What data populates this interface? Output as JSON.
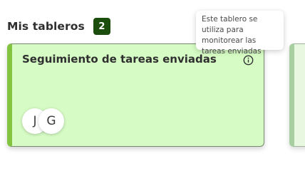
{
  "section": {
    "title": "Mis tableros",
    "count": "2"
  },
  "card": {
    "title": "Seguimiento de tareas enviadas",
    "info_icon": "info-circle-icon",
    "accent_color": "#82c33f",
    "background_color": "#d6fbc4",
    "avatars": [
      {
        "initial": "J"
      },
      {
        "initial": "G"
      }
    ]
  },
  "tooltip": {
    "text": "Este tablero se utiliza para monitorear las tareas enviadas"
  },
  "colors": {
    "badge": "#1b4d0c"
  }
}
